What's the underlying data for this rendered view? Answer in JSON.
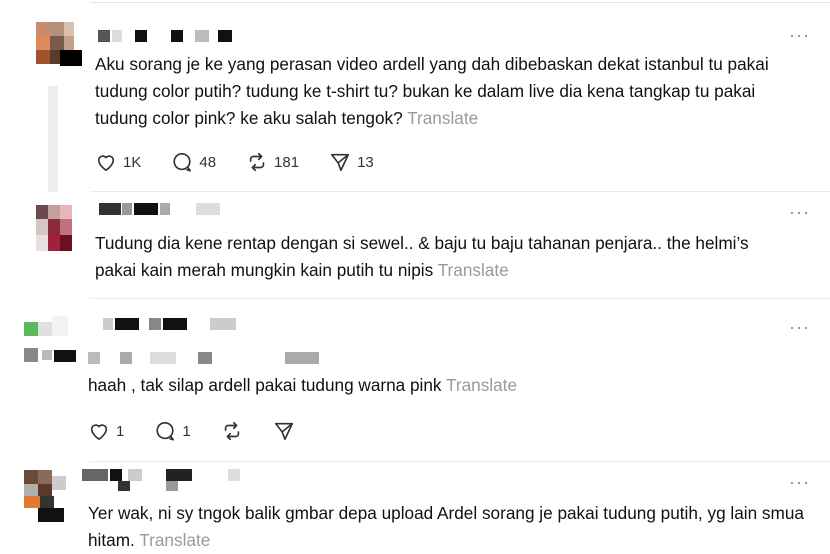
{
  "posts": [
    {
      "text": "Aku sorang je ke yang perasan video ardell yang dah dibebaskan dekat istanbul tu pakai tudung color putih? tudung ke t-shirt tu? bukan ke dalam live dia kena tangkap tu pakai tudung color pink? ke aku salah tengok?",
      "translate": "Translate",
      "likes": "1K",
      "replies": "48",
      "reposts": "181",
      "shares": "13",
      "more": "···"
    },
    {
      "text": "Tudung dia kene rentap dengan si sewel.. & baju tu baju tahanan penjara.. the helmi’s pakai kain merah mungkin kain putih tu nipis",
      "translate": "Translate",
      "more": "···"
    },
    {
      "text": "haah , tak silap ardell pakai tudung warna pink",
      "translate": "Translate",
      "likes": "1",
      "replies": "1",
      "more": "···"
    },
    {
      "text": "Yer wak, ni sy tngok balik gmbar depa upload Ardel sorang je pakai tudung putih, yg lain smua hitam.",
      "translate": "Translate",
      "more": "···"
    }
  ],
  "icons": [
    "heart-icon",
    "reply-icon",
    "repost-icon",
    "share-icon",
    "more-icon"
  ]
}
